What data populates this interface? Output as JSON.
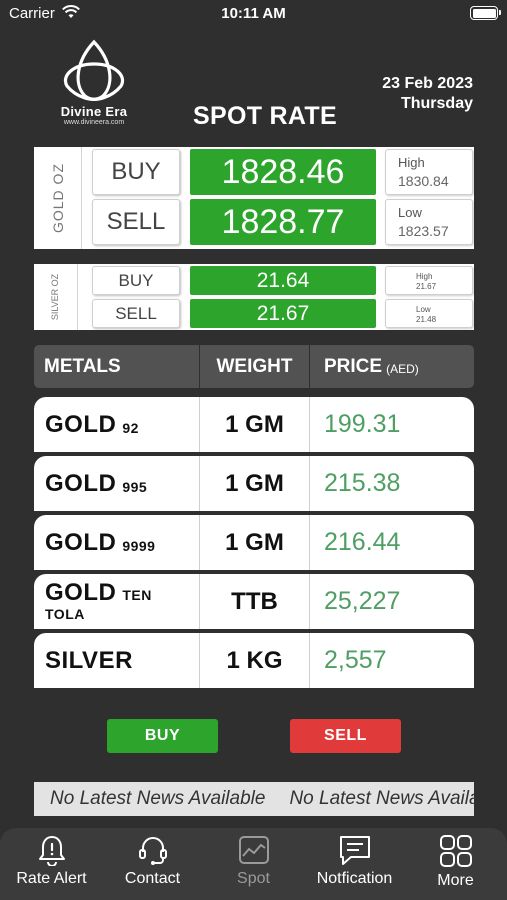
{
  "status_bar": {
    "carrier": "Carrier",
    "time": "10:11 AM"
  },
  "brand": {
    "name": "Divine Era",
    "url": "www.divineera.com"
  },
  "header": {
    "title": "SPOT RATE",
    "date": "23 Feb 2023",
    "day": "Thursday"
  },
  "gold_spot": {
    "label": "GOLD OZ",
    "buy_label": "BUY",
    "buy_rate": "1828.46",
    "sell_label": "SELL",
    "sell_rate": "1828.77",
    "high_label": "High",
    "high_value": "1830.84",
    "low_label": "Low",
    "low_value": "1823.57"
  },
  "silver_spot": {
    "label": "SILVER OZ",
    "buy_label": "BUY",
    "buy_rate": "21.64",
    "sell_label": "SELL",
    "sell_rate": "21.67",
    "high_label": "High",
    "high_value": "21.67",
    "low_label": "Low",
    "low_value": "21.48"
  },
  "table": {
    "headers": {
      "metals": "METALS",
      "weight": "WEIGHT",
      "price": "PRICE",
      "price_unit": "(AED)"
    },
    "rows": [
      {
        "metal": "GOLD",
        "purity": "92",
        "weight": "1 GM",
        "price": "199.31"
      },
      {
        "metal": "GOLD",
        "purity": "995",
        "weight": "1 GM",
        "price": "215.38"
      },
      {
        "metal": "GOLD",
        "purity": "9999",
        "weight": "1 GM",
        "price": "216.44"
      },
      {
        "metal": "GOLD",
        "purity": "TEN",
        "purity2": "TOLA",
        "weight": "TTB",
        "price": "25,227"
      },
      {
        "metal": "SILVER",
        "purity": "",
        "weight": "1 KG",
        "price": "2,557"
      }
    ]
  },
  "actions": {
    "buy": "BUY",
    "sell": "SELL"
  },
  "ticker": {
    "text1": "No Latest News Available",
    "text2": "No Latest News Available"
  },
  "tabs": [
    {
      "label": "Rate Alert",
      "icon": "bell-icon"
    },
    {
      "label": "Contact",
      "icon": "headset-icon"
    },
    {
      "label": "Spot",
      "icon": "chart-icon"
    },
    {
      "label": "Notfication",
      "icon": "message-icon"
    },
    {
      "label": "More",
      "icon": "grid-icon"
    }
  ],
  "colors": {
    "background": "#2f2f2f",
    "green": "#2da52d",
    "red": "#e03a3a",
    "price_text": "#4f9e63"
  }
}
